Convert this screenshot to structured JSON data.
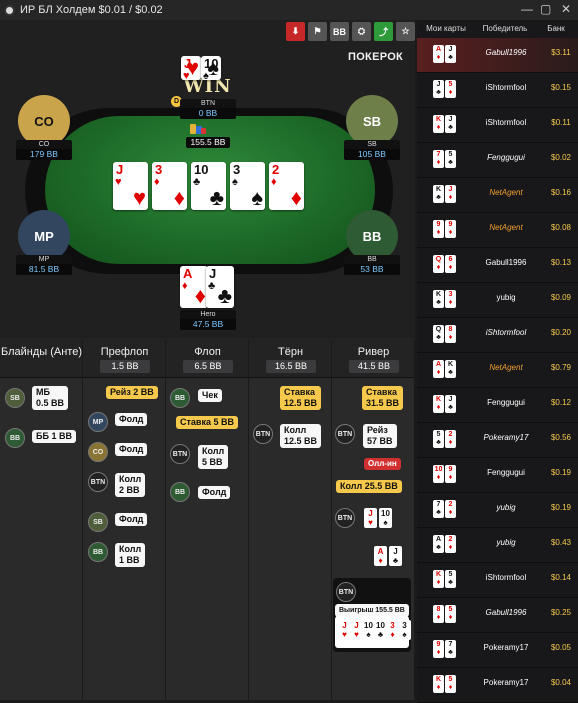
{
  "window": {
    "title": "ИР БЛ Холдем $0.01 / $0.02"
  },
  "toolbar": {
    "buttons": [
      {
        "name": "download-icon",
        "label": "⬇",
        "color": "#c62828"
      },
      {
        "name": "flag-icon",
        "label": "⚑",
        "color": "#555"
      },
      {
        "name": "bb-toggle",
        "label": "BB",
        "color": "#555"
      },
      {
        "name": "incognito-icon",
        "label": "⛭",
        "color": "#555"
      },
      {
        "name": "share-icon",
        "label": "⤴",
        "color": "#2e9b3a"
      },
      {
        "name": "star-icon",
        "label": "☆",
        "color": "#555"
      }
    ]
  },
  "brand": "ПОКЕРОК",
  "table": {
    "win_label": "WIN",
    "btn": {
      "name": "BTN",
      "stack": "0 BB",
      "cards": [
        {
          "r": "J",
          "s": "♥",
          "red": true
        },
        {
          "r": "10",
          "s": "♠",
          "red": false
        }
      ]
    },
    "co": {
      "label": "CO",
      "name": "CO",
      "stack": "179 BB"
    },
    "sb": {
      "label": "SB",
      "name": "SB",
      "stack": "105 BB"
    },
    "mp": {
      "label": "MP",
      "name": "MP",
      "stack": "81.5 BB"
    },
    "bb": {
      "label": "BB",
      "name": "BB",
      "stack": "53 BB"
    },
    "hero": {
      "name": "Hero",
      "stack": "47.5 BB",
      "cards": [
        {
          "r": "A",
          "s": "♦",
          "red": true
        },
        {
          "r": "J",
          "s": "♣",
          "red": false
        }
      ]
    },
    "pot": "155.5 BB",
    "dealer_label": "D",
    "board": [
      {
        "r": "J",
        "s": "♥",
        "red": true
      },
      {
        "r": "3",
        "s": "♦",
        "red": true
      },
      {
        "r": "10",
        "s": "♣",
        "red": false
      },
      {
        "r": "3",
        "s": "♠",
        "red": false
      },
      {
        "r": "2",
        "s": "♦",
        "red": true
      }
    ]
  },
  "history": {
    "columns": [
      {
        "title": "Блайнды (Анте)",
        "pot": ""
      },
      {
        "title": "Префлоп",
        "pot": "1.5 BB"
      },
      {
        "title": "Флоп",
        "pot": "6.5 BB"
      },
      {
        "title": "Тёрн",
        "pot": "16.5 BB"
      },
      {
        "title": "Ривер",
        "pot": "41.5 BB"
      }
    ],
    "blinds": [
      {
        "pos": "SB",
        "text": "МБ\n0.5 BB"
      },
      {
        "pos": "BB",
        "text": "ББ 1 BB"
      }
    ],
    "preflop": {
      "raise": "Рейз 2 BB",
      "actions": [
        {
          "pos": "MP",
          "text": "Фолд"
        },
        {
          "pos": "CO",
          "text": "Фолд"
        },
        {
          "pos": "BTN",
          "text": "Колл\n2 BB"
        },
        {
          "pos": "SB",
          "text": "Фолд"
        },
        {
          "pos": "BB",
          "text": "Колл\n1 BB"
        }
      ]
    },
    "flop": {
      "check": {
        "pos": "BB",
        "text": "Чек"
      },
      "bet": "Ставка 5 BB",
      "call": {
        "pos": "BTN",
        "text": "Колл\n5 BB"
      },
      "fold": {
        "pos": "BB",
        "text": "Фолд"
      }
    },
    "turn": {
      "bet": "Ставка\n12.5 BB",
      "call": {
        "pos": "BTN",
        "text": "Колл\n12.5 BB"
      }
    },
    "river": {
      "bet": "Ставка\n31.5 BB",
      "raise": {
        "pos": "BTN",
        "text": "Рейз\n57 BB"
      },
      "allin": "Олл-ин",
      "call": "Колл 25.5 BB",
      "btn_cards": [
        {
          "r": "J",
          "s": "♥",
          "red": true
        },
        {
          "r": "10",
          "s": "♠",
          "red": false
        }
      ],
      "hero_cards": [
        {
          "r": "A",
          "s": "♦",
          "red": true
        },
        {
          "r": "J",
          "s": "♣",
          "red": false
        }
      ],
      "win_pos": "BTN",
      "win_text": "Выигрыш 155.5 BB",
      "win_cards": [
        {
          "r": "J",
          "s": "♥",
          "red": true
        },
        {
          "r": "J",
          "s": "♥",
          "red": true
        },
        {
          "r": "10",
          "s": "♠",
          "red": false
        },
        {
          "r": "10",
          "s": "♣",
          "red": false
        },
        {
          "r": "3",
          "s": "♦",
          "red": true
        },
        {
          "r": "3",
          "s": "♠",
          "red": false
        }
      ]
    }
  },
  "sidebar": {
    "headers": {
      "cards": "Мои карты",
      "winner": "Победитель",
      "bank": "Банк"
    },
    "rows": [
      {
        "c1": {
          "r": "A",
          "s": "♦",
          "red": true
        },
        "c2": {
          "r": "J",
          "s": "♣",
          "red": false
        },
        "winner": "Gabull1996",
        "bank": "$3.11",
        "italic": true,
        "gold": false,
        "hl": true
      },
      {
        "c1": {
          "r": "J",
          "s": "♣",
          "red": false
        },
        "c2": {
          "r": "5",
          "s": "♦",
          "red": true
        },
        "winner": "iShtormfool",
        "bank": "$0.15",
        "italic": false,
        "gold": false
      },
      {
        "c1": {
          "r": "K",
          "s": "♦",
          "red": true
        },
        "c2": {
          "r": "J",
          "s": "♣",
          "red": false
        },
        "winner": "iShtormfool",
        "bank": "$0.11",
        "italic": false,
        "gold": false
      },
      {
        "c1": {
          "r": "7",
          "s": "♦",
          "red": true
        },
        "c2": {
          "r": "5",
          "s": "♣",
          "red": false
        },
        "winner": "Fenggugui",
        "bank": "$0.02",
        "italic": true,
        "gold": false
      },
      {
        "c1": {
          "r": "K",
          "s": "♣",
          "red": false
        },
        "c2": {
          "r": "J",
          "s": "♦",
          "red": true
        },
        "winner": "NetAgent",
        "bank": "$0.16",
        "italic": true,
        "gold": true
      },
      {
        "c1": {
          "r": "9",
          "s": "♦",
          "red": true
        },
        "c2": {
          "r": "9",
          "s": "♦",
          "red": true
        },
        "winner": "NetAgent",
        "bank": "$0.08",
        "italic": true,
        "gold": true
      },
      {
        "c1": {
          "r": "Q",
          "s": "♦",
          "red": true
        },
        "c2": {
          "r": "6",
          "s": "♦",
          "red": true
        },
        "winner": "Gabull1996",
        "bank": "$0.13",
        "italic": false,
        "gold": false
      },
      {
        "c1": {
          "r": "K",
          "s": "♣",
          "red": false
        },
        "c2": {
          "r": "3",
          "s": "♦",
          "red": true
        },
        "winner": "yubig",
        "bank": "$0.09",
        "italic": false,
        "gold": false
      },
      {
        "c1": {
          "r": "Q",
          "s": "♣",
          "red": false
        },
        "c2": {
          "r": "8",
          "s": "♦",
          "red": true
        },
        "winner": "iShtormfool",
        "bank": "$0.20",
        "italic": true,
        "gold": false
      },
      {
        "c1": {
          "r": "A",
          "s": "♦",
          "red": true
        },
        "c2": {
          "r": "K",
          "s": "♣",
          "red": false
        },
        "winner": "NetAgent",
        "bank": "$0.79",
        "italic": true,
        "gold": true
      },
      {
        "c1": {
          "r": "K",
          "s": "♦",
          "red": true
        },
        "c2": {
          "r": "J",
          "s": "♣",
          "red": false
        },
        "winner": "Fenggugui",
        "bank": "$0.12",
        "italic": false,
        "gold": false
      },
      {
        "c1": {
          "r": "5",
          "s": "♣",
          "red": false
        },
        "c2": {
          "r": "2",
          "s": "♦",
          "red": true
        },
        "winner": "Pokeramy17",
        "bank": "$0.56",
        "italic": true,
        "gold": false
      },
      {
        "c1": {
          "r": "10",
          "s": "♦",
          "red": true
        },
        "c2": {
          "r": "9",
          "s": "♦",
          "red": true
        },
        "winner": "Fenggugui",
        "bank": "$0.19",
        "italic": false,
        "gold": false
      },
      {
        "c1": {
          "r": "7",
          "s": "♣",
          "red": false
        },
        "c2": {
          "r": "2",
          "s": "♦",
          "red": true
        },
        "winner": "yubig",
        "bank": "$0.19",
        "italic": true,
        "gold": false
      },
      {
        "c1": {
          "r": "A",
          "s": "♣",
          "red": false
        },
        "c2": {
          "r": "2",
          "s": "♦",
          "red": true
        },
        "winner": "yubig",
        "bank": "$0.43",
        "italic": true,
        "gold": false
      },
      {
        "c1": {
          "r": "K",
          "s": "♦",
          "red": true
        },
        "c2": {
          "r": "5",
          "s": "♣",
          "red": false
        },
        "winner": "iShtormfool",
        "bank": "$0.14",
        "italic": false,
        "gold": false
      },
      {
        "c1": {
          "r": "8",
          "s": "♦",
          "red": true
        },
        "c2": {
          "r": "5",
          "s": "♦",
          "red": true
        },
        "winner": "Gabull1996",
        "bank": "$0.25",
        "italic": true,
        "gold": false
      },
      {
        "c1": {
          "r": "9",
          "s": "♦",
          "red": true
        },
        "c2": {
          "r": "7",
          "s": "♣",
          "red": false
        },
        "winner": "Pokeramy17",
        "bank": "$0.05",
        "italic": false,
        "gold": false
      },
      {
        "c1": {
          "r": "K",
          "s": "♦",
          "red": true
        },
        "c2": {
          "r": "5",
          "s": "♦",
          "red": true
        },
        "winner": "Pokeramy17",
        "bank": "$0.04",
        "italic": false,
        "gold": false
      }
    ]
  }
}
